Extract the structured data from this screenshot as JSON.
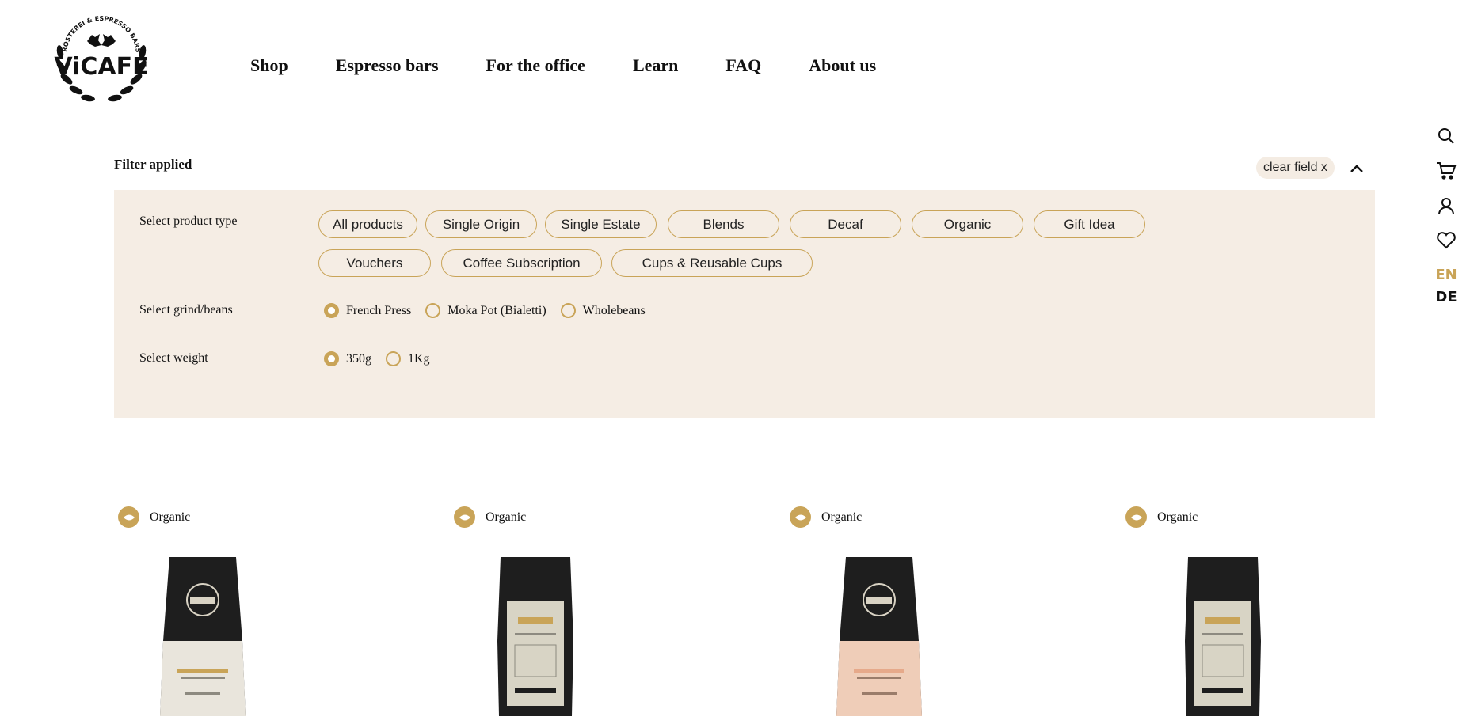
{
  "brand": {
    "logo_text": "ViCAFE",
    "logo_arc_text": "RÖSTEREI & ESPRESSO BARS"
  },
  "nav": {
    "items": [
      "Shop",
      "Espresso bars",
      "For the office",
      "Learn",
      "FAQ",
      "About us"
    ]
  },
  "rail": {
    "icons": [
      "search-icon",
      "cart-icon",
      "account-icon",
      "heart-icon"
    ],
    "lang_en": "EN",
    "lang_de": "DE"
  },
  "filter": {
    "title": "Filter applied",
    "clear_label": "clear field x",
    "product_type": {
      "label": "Select product type",
      "options": [
        "All products",
        "Single Origin",
        "Single Estate",
        "Blends",
        "Decaf",
        "Organic",
        "Gift Idea",
        "Vouchers",
        "Coffee Subscription",
        "Cups & Reusable Cups"
      ]
    },
    "grind": {
      "label": "Select grind/beans",
      "options": [
        "French Press",
        "Moka Pot (Bialetti)",
        "Wholebeans"
      ],
      "selected": "French Press"
    },
    "weight": {
      "label": "Select weight",
      "options": [
        "350g",
        "1Kg"
      ],
      "selected": "350g"
    }
  },
  "products": [
    {
      "badge": "Organic",
      "bag_color": "#e9e5dc"
    },
    {
      "badge": "Organic",
      "bag_color": "#d8d4c5"
    },
    {
      "badge": "Organic",
      "bag_color": "#efcdb8"
    },
    {
      "badge": "Organic",
      "bag_color": "#d8d4c5"
    }
  ],
  "colors": {
    "accent": "#c9a458",
    "panel_bg": "#f5ede4",
    "bag_black": "#1e1e1e"
  }
}
